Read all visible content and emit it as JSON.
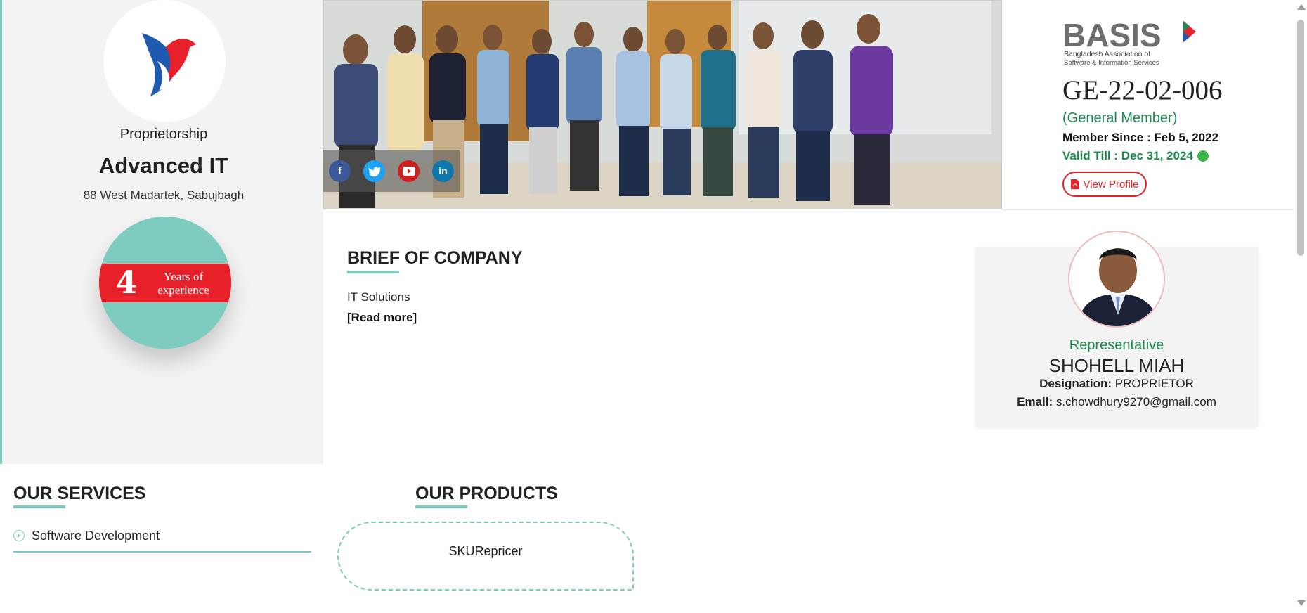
{
  "company": {
    "type": "Proprietorship",
    "name": "Advanced IT",
    "address": "88 West Madartek, Sabujbagh",
    "experience": {
      "years": "4",
      "label": "Years of experience"
    }
  },
  "social": [
    "facebook-icon",
    "twitter-icon",
    "youtube-icon",
    "linkedin-icon"
  ],
  "membership": {
    "logo_text": "BASIS",
    "logo_subtitle_1": "Bangladesh Association of",
    "logo_subtitle_2": "Software & Information Services",
    "member_id": "GE-22-02-006",
    "member_type": "(General Member)",
    "member_since": "Member Since : Feb 5, 2022",
    "valid_till": "Valid Till : Dec 31, 2024",
    "view_profile_label": "View Profile"
  },
  "brief": {
    "title": "BRIEF OF COMPANY",
    "text": "IT Solutions",
    "read_more": "[Read more]"
  },
  "representative": {
    "label": "Representative",
    "name": "SHOHELL MIAH",
    "designation_label": "Designation:",
    "designation": "PROPRIETOR",
    "email_label": "Email:",
    "email": "s.chowdhury9270@gmail.com"
  },
  "services": {
    "title": "OUR SERVICES",
    "items": [
      "Software Development"
    ]
  },
  "products": {
    "title": "OUR PRODUCTS",
    "items": [
      "SKURepricer"
    ]
  },
  "colors": {
    "accent": "#7ecbc0",
    "red": "#e8202a",
    "green": "#1f8a50"
  }
}
